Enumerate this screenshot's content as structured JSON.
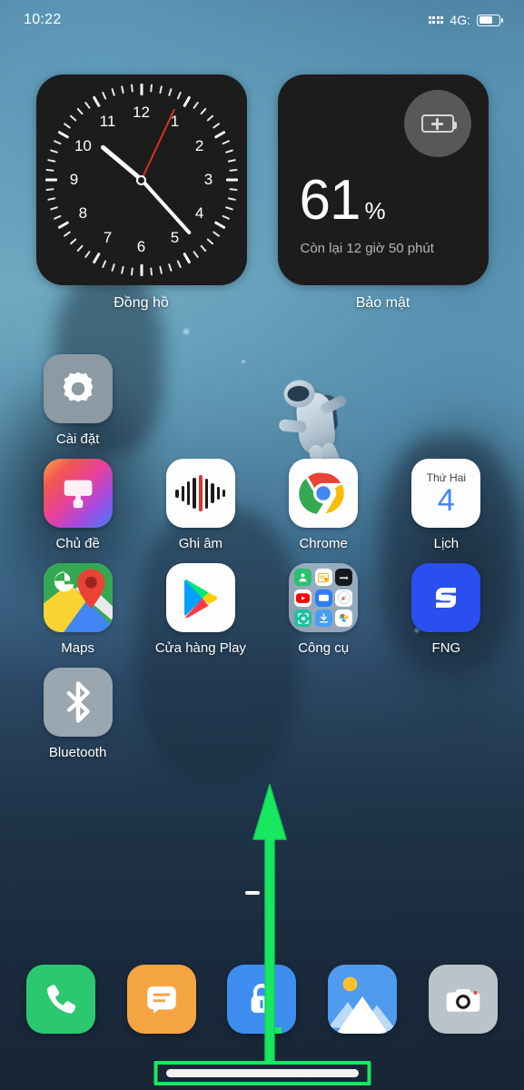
{
  "status_bar": {
    "time": "10:22",
    "network": "4G:",
    "signal_icon": "signal-dots-icon",
    "battery_icon": "battery-icon",
    "battery_fill_percent": 58
  },
  "widgets": [
    {
      "id": "clock-widget",
      "label": "Đồng hồ",
      "type": "analog-clock",
      "hour_numbers": [
        "12",
        "1",
        "2",
        "3",
        "4",
        "5",
        "6",
        "7",
        "8",
        "9",
        "10",
        "11"
      ],
      "hour_hand_deg": 310,
      "minute_hand_deg": 138,
      "second_hand_deg": 25
    },
    {
      "id": "battery-widget",
      "label": "Bảo mật",
      "type": "battery-status",
      "percent": "61",
      "percent_symbol": "%",
      "remaining_text": "Còn lại 12 giờ 50 phút",
      "icon": "battery-plus-icon"
    }
  ],
  "app_rows": [
    [
      {
        "label": "Cài đặt",
        "icon": "gear-icon",
        "style": "ic-settings"
      }
    ],
    [
      {
        "label": "Chủ đề",
        "icon": "paint-brush-icon",
        "style": "ic-themes"
      },
      {
        "label": "Ghi âm",
        "icon": "waveform-icon",
        "style": "ic-white"
      },
      {
        "label": "Chrome",
        "icon": "chrome-icon",
        "style": "ic-white"
      },
      {
        "label": "Lịch",
        "icon": "calendar-icon",
        "style": "ic-white",
        "day_of_week": "Thứ Hai",
        "day_number": "4"
      }
    ],
    [
      {
        "label": "Maps",
        "icon": "google-maps-icon",
        "style": "ic-white"
      },
      {
        "label": "Cửa hàng Play",
        "icon": "play-store-icon",
        "style": "ic-white"
      },
      {
        "label": "Công cụ",
        "icon": "folder-icon",
        "style": "ic-folder"
      },
      {
        "label": "FNG",
        "icon": "fng-logo-icon",
        "style": "ic-fng"
      }
    ],
    [
      {
        "label": "Bluetooth",
        "icon": "bluetooth-icon",
        "style": "ic-bluetooth"
      }
    ]
  ],
  "folder_mini_icons": [
    "contacts-icon",
    "notes-icon",
    "dark-app-icon",
    "youtube-icon",
    "messages-icon",
    "compass-icon",
    "scanner-icon",
    "download-icon",
    "pinwheel-icon"
  ],
  "dock": [
    {
      "label": "Điện thoại",
      "icon": "phone-icon",
      "style": "ic-phone"
    },
    {
      "label": "Tin nhắn",
      "icon": "message-icon",
      "style": "ic-messages"
    },
    {
      "label": "Bảo mật",
      "icon": "lock-icon",
      "style": "ic-security"
    },
    {
      "label": "Thư viện",
      "icon": "gallery-icon",
      "style": "ic-gallery"
    },
    {
      "label": "Máy ảnh",
      "icon": "camera-icon",
      "style": "ic-camera"
    }
  ],
  "page_indicator": {
    "pages": 2,
    "active": 1
  },
  "annotations": {
    "swipe_arrow": "swipe-up-arrow",
    "gesture_bar_highlight": "gesture-bar-highlight",
    "color": "#18e85f"
  },
  "colors": {
    "accent_green": "#18e85f",
    "widget_bg": "#1c1c1c",
    "second_hand": "#d93025",
    "calendar_blue": "#4285f4"
  }
}
